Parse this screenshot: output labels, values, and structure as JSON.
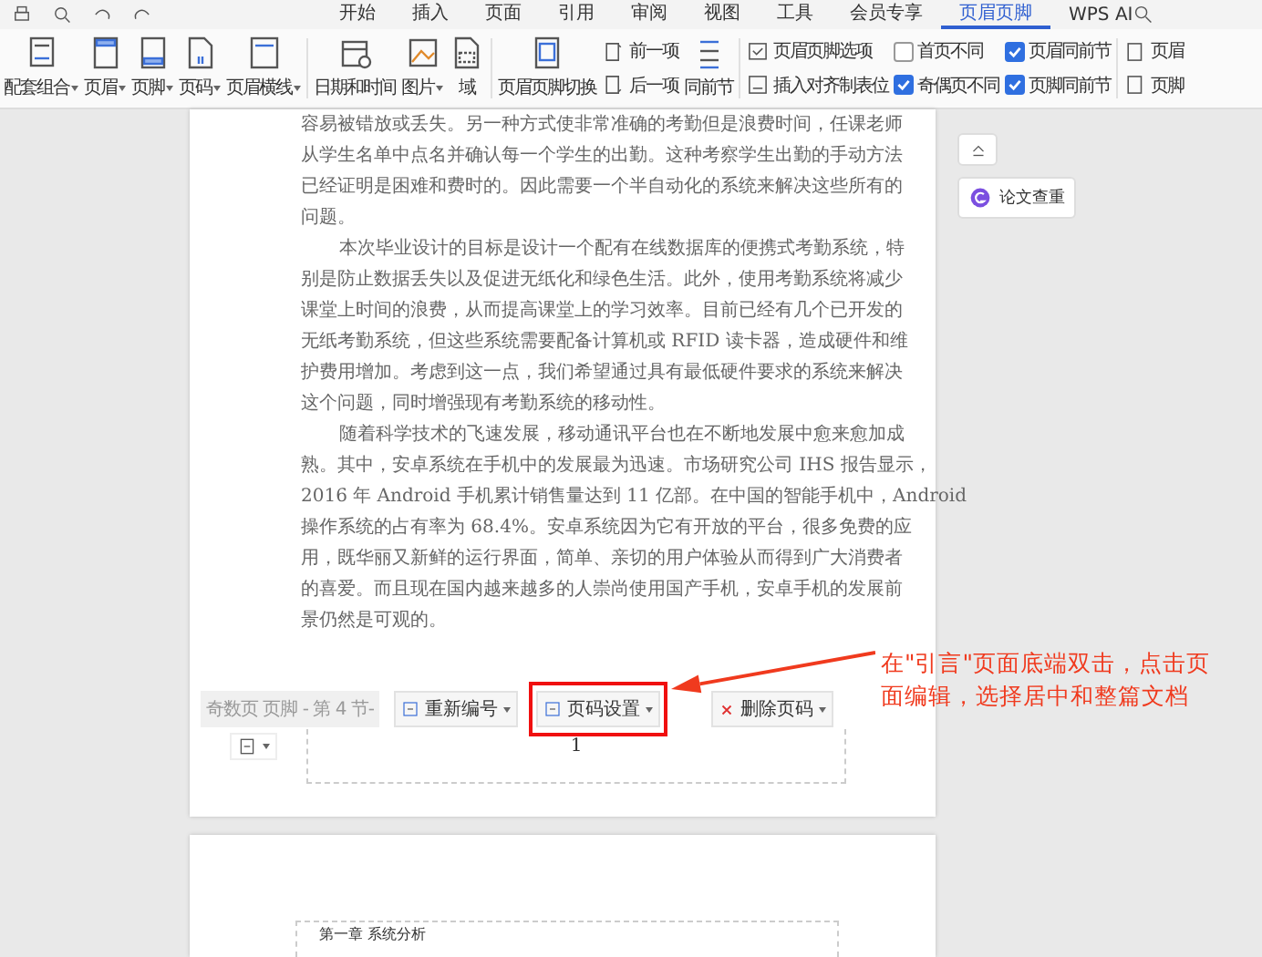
{
  "top_bar": {
    "tabs": [
      {
        "label": "开始",
        "selected": false
      },
      {
        "label": "插入",
        "selected": false
      },
      {
        "label": "页面",
        "selected": false
      },
      {
        "label": "引用",
        "selected": false
      },
      {
        "label": "审阅",
        "selected": false
      },
      {
        "label": "视图",
        "selected": false
      },
      {
        "label": "工具",
        "selected": false
      },
      {
        "label": "会员专享",
        "selected": false
      },
      {
        "label": "页眉页脚",
        "selected": true
      }
    ],
    "ai_label": "WPS AI"
  },
  "ribbon": {
    "group_1": [
      {
        "label": "配套组合",
        "dropdown": true
      },
      {
        "label": "页眉",
        "dropdown": true
      },
      {
        "label": "页脚",
        "dropdown": true
      },
      {
        "label": "页码",
        "dropdown": true
      },
      {
        "label": "页眉横线",
        "dropdown": true
      }
    ],
    "group_2": [
      {
        "label": "日期和时间",
        "dropdown": false
      },
      {
        "label": "图片",
        "dropdown": true
      },
      {
        "label": "域",
        "dropdown": false
      }
    ],
    "switch_button": "页眉页脚切换",
    "previous": "前一项",
    "next": "后一项",
    "same_as_previous": "同前节",
    "options": [
      "页眉页脚选项",
      "插入对齐制表位"
    ],
    "checkboxes": [
      {
        "label": "首页不同",
        "checked": false
      },
      {
        "label": "奇偶页不同",
        "checked": true
      },
      {
        "label": "页眉同前节",
        "checked": true
      },
      {
        "label": "页脚同前节",
        "checked": true
      }
    ],
    "cut_items": [
      "页眉",
      "页脚"
    ]
  },
  "document": {
    "paragraphs": [
      {
        "indent": false,
        "lines": [
          "容易被错放或丢失。另一种方式使非常准确的考勤但是浪费时间，任课老师",
          "从学生名单中点名并确认每一个学生的出勤。这种考察学生出勤的手动方法",
          "已经证明是困难和费时的。因此需要一个半自动化的系统来解决这些所有的",
          "问题。"
        ]
      },
      {
        "indent": true,
        "lines": [
          "本次毕业设计的目标是设计一个配有在线数据库的便携式考勤系统，特",
          "别是防止数据丢失以及促进无纸化和绿色生活。此外，使用考勤系统将减少",
          "课堂上时间的浪费，从而提高课堂上的学习效率。目前已经有几个已开发的",
          "无纸考勤系统，但这些系统需要配备计算机或 RFID 读卡器，造成硬件和维",
          "护费用增加。考虑到这一点，我们希望通过具有最低硬件要求的系统来解决",
          "这个问题，同时增强现有考勤系统的移动性。"
        ]
      },
      {
        "indent": true,
        "lines": [
          "随着科学技术的飞速发展，移动通讯平台也在不断地发展中愈来愈加成",
          "熟。其中，安卓系统在手机中的发展最为迅速。市场研究公司 IHS 报告显示，",
          "2016 年 Android 手机累计销售量达到 11 亿部。在中国的智能手机中，Android",
          "操作系统的占有率为 68.4%。安卓系统因为它有开放的平台，很多免费的应",
          "用，既华丽又新鲜的运行界面，简单、亲切的用户体验从而得到广大消费者",
          "的喜爱。而且现在国内越来越多的人崇尚使用国产手机，安卓手机的发展前",
          "景仍然是可观的。"
        ]
      }
    ],
    "footer_label": "奇数页 页脚 - 第 4 节-",
    "footer_buttons": [
      {
        "label": "重新编号",
        "highlighted": false
      },
      {
        "label": "页码设置",
        "highlighted": true
      },
      {
        "label": "删除页码",
        "highlighted": false
      }
    ],
    "page_number": "1",
    "next_page_header": "第一章  系统分析"
  },
  "side_panel": {
    "check_button": "论文查重"
  },
  "annotation": {
    "text": "在\"引言\"页面底端双击，点击页面编辑，选择居中和整篇文档"
  }
}
